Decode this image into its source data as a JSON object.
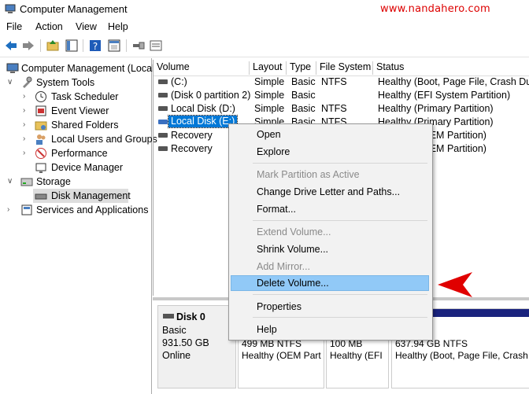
{
  "window": {
    "title": "Computer Management",
    "watermark": "www.nandahero.com"
  },
  "menubar": [
    "File",
    "Action",
    "View",
    "Help"
  ],
  "toolbar": {
    "icons": [
      "back-arrow-icon",
      "forward-arrow-icon",
      "up-folder-icon",
      "show-hide-tree-icon",
      "help-icon",
      "properties-icon",
      "connect-icon",
      "console-icon"
    ]
  },
  "tree": {
    "root": "Computer Management (Local",
    "system_tools": "System Tools",
    "task_scheduler": "Task Scheduler",
    "event_viewer": "Event Viewer",
    "shared_folders": "Shared Folders",
    "local_users": "Local Users and Groups",
    "performance": "Performance",
    "device_manager": "Device Manager",
    "storage": "Storage",
    "disk_management": "Disk Management",
    "services": "Services and Applications"
  },
  "volumes": {
    "headers": [
      "Volume",
      "Layout",
      "Type",
      "File System",
      "Status"
    ],
    "rows": [
      {
        "volume": "(C:)",
        "layout": "Simple",
        "type": "Basic",
        "fs": "NTFS",
        "status": "Healthy (Boot, Page File, Crash Dum"
      },
      {
        "volume": "(Disk 0 partition 2)",
        "layout": "Simple",
        "type": "Basic",
        "fs": "",
        "status": "Healthy (EFI System Partition)"
      },
      {
        "volume": "Local Disk (D:)",
        "layout": "Simple",
        "type": "Basic",
        "fs": "NTFS",
        "status": "Healthy (Primary Partition)"
      },
      {
        "volume": "Local Disk (E:)",
        "layout": "Simple",
        "type": "Basic",
        "fs": "NTFS",
        "status": "Healthy (Primary Partition)"
      },
      {
        "volume": "Recovery",
        "layout": "",
        "type": "",
        "fs": "",
        "status": "OEM Partition)"
      },
      {
        "volume": "Recovery",
        "layout": "",
        "type": "",
        "fs": "",
        "status": "OEM Partition)"
      }
    ]
  },
  "disk": {
    "name": "Disk 0",
    "type": "Basic",
    "size": "931.50 GB",
    "state": "Online",
    "segments": [
      {
        "line1": "499 MB NTFS",
        "line2": "Healthy (OEM Part"
      },
      {
        "line1": "100 MB",
        "line2": "Healthy (EFI"
      },
      {
        "line1": "637.94 GB NTFS",
        "line2": "Healthy (Boot, Page File, Crash"
      }
    ]
  },
  "context_menu": {
    "open": "Open",
    "explore": "Explore",
    "mark_active": "Mark Partition as Active",
    "change_letter": "Change Drive Letter and Paths...",
    "format": "Format...",
    "extend": "Extend Volume...",
    "shrink": "Shrink Volume...",
    "add_mirror": "Add Mirror...",
    "delete": "Delete Volume...",
    "properties": "Properties",
    "help": "Help"
  },
  "colors": {
    "accent_arrow": "#e00000",
    "selection": "#0078d7",
    "menu_highlight": "#91c9f7",
    "disk_bar": "#1a237e"
  }
}
